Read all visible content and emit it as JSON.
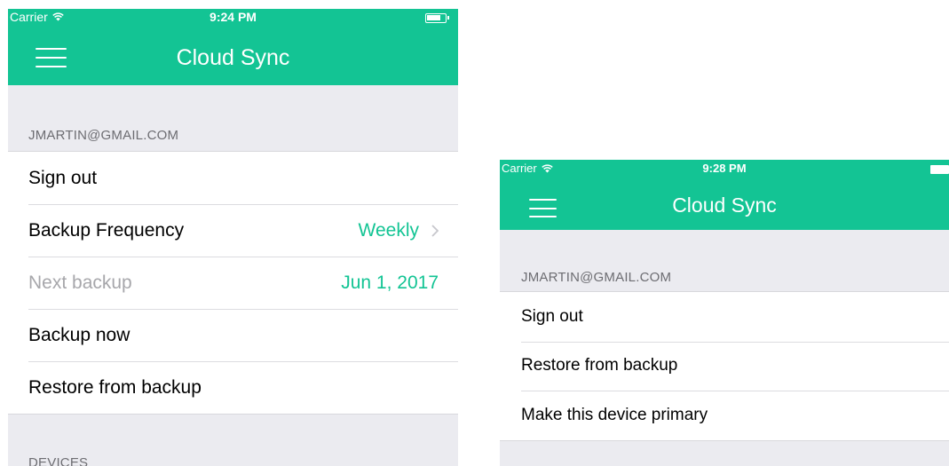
{
  "screens": [
    {
      "status_bar": {
        "carrier": "Carrier",
        "time": "9:24 PM"
      },
      "nav_title": "Cloud Sync",
      "account_header": "JMARTIN@GMAIL.COM",
      "rows": [
        {
          "label": "Sign out",
          "value": ""
        },
        {
          "label": "Backup Frequency",
          "value": "Weekly"
        },
        {
          "label": "Next backup",
          "value": "Jun 1, 2017"
        },
        {
          "label": "Backup now",
          "value": ""
        },
        {
          "label": "Restore from backup",
          "value": ""
        }
      ],
      "devices_header": "DEVICES"
    },
    {
      "status_bar": {
        "carrier": "Carrier",
        "time": "9:28 PM"
      },
      "nav_title": "Cloud Sync",
      "account_header": "JMARTIN@GMAIL.COM",
      "rows": [
        {
          "label": "Sign out"
        },
        {
          "label": "Restore from backup"
        },
        {
          "label": "Make this device primary"
        }
      ]
    }
  ],
  "colors": {
    "accent": "#13c494",
    "background": "#ebebf0",
    "disabled_text": "#a7a7ab"
  },
  "icons": {
    "menu": "hamburger-menu-icon",
    "wifi": "wifi-icon",
    "battery": "battery-icon",
    "chevron": "chevron-right-icon"
  }
}
